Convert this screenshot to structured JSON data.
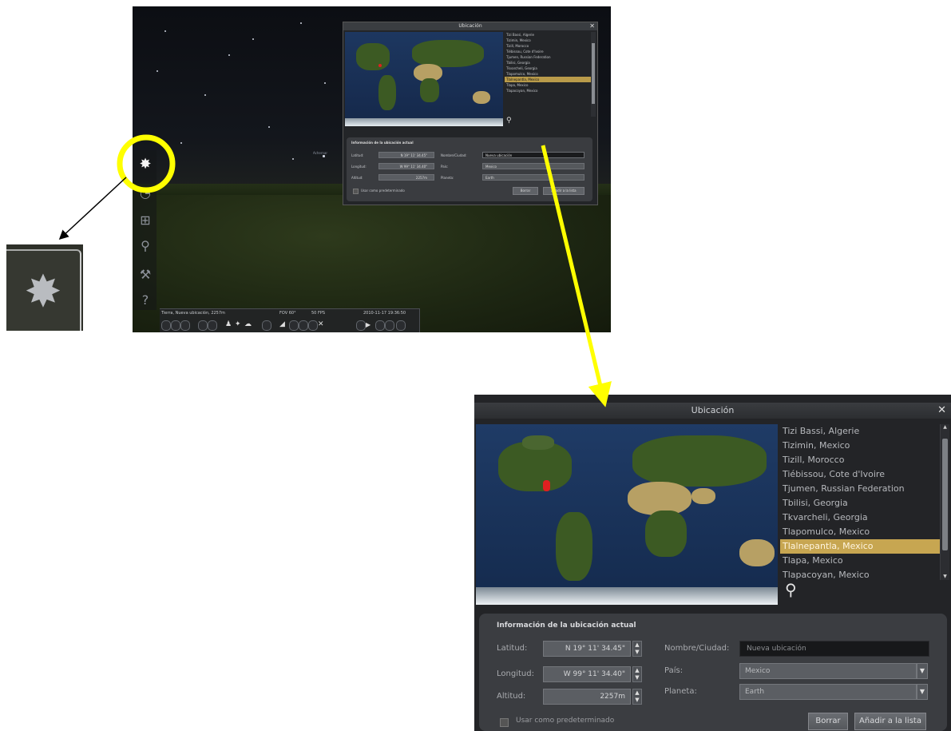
{
  "small_window": {
    "title": "Ubicación",
    "close": "✕",
    "locations": [
      "Tizi Bassi, Algerie",
      "Tizimin, Mexico",
      "Tizill, Morocco",
      "Tiébissou, Cote d'Ivoire",
      "Tjumen, Russian Federation",
      "Tbilisi, Georgia",
      "Tkvarcheli, Georgia",
      "Tlapomulco, Mexico",
      "Tlalnepantla, Mexico",
      "Tlapa, Mexico",
      "Tlapacoyan, Mexico"
    ],
    "selected_index": 8,
    "info_heading": "Información de la ubicación actual",
    "latitud_label": "Latitud:",
    "latitud_value": "N 19° 11' 34.45\"",
    "longitud_label": "Longitud:",
    "longitud_value": "W 99° 11' 34.40\"",
    "altitud_label": "Altitud:",
    "altitud_value": "2257m",
    "nombre_label": "Nombre/Ciudad:",
    "nombre_value": "Nueva ubicación",
    "pais_label": "País:",
    "pais_value": "Mexico",
    "planeta_label": "Planeta:",
    "planeta_value": "Earth",
    "default_label": "Usar como predeterminado",
    "delete_button": "Borrar",
    "add_button": "Añadir a la lista"
  },
  "status_bar": {
    "location": "Tierra, Nueva ubicación, 2257m",
    "fov": "FOV 60°",
    "fps": "50 FPS",
    "datetime": "2010-11-17   19:36:50"
  },
  "sky_label": "Achernar",
  "large_window": {
    "title": "Ubicación",
    "close": "✕",
    "locations": [
      "Tizi Bassi, Algerie",
      "Tizimin, Mexico",
      "Tizill, Morocco",
      "Tiébissou, Cote d'Ivoire",
      "Tjumen, Russian Federation",
      "Tbilisi, Georgia",
      "Tkvarcheli, Georgia",
      "Tlapomulco, Mexico",
      "Tlalnepantla, Mexico",
      "Tlapa, Mexico",
      "Tlapacoyan, Mexico"
    ],
    "selected_index": 8,
    "info_heading": "Información de la ubicación actual",
    "latitud_label": "Latitud:",
    "latitud_value": "N 19° 11' 34.45\"",
    "longitud_label": "Longitud:",
    "longitud_value": "W 99° 11' 34.40\"",
    "altitud_label": "Altitud:",
    "altitud_value": "2257m",
    "nombre_label": "Nombre/Ciudad:",
    "nombre_value": "Nueva ubicación",
    "pais_label": "País:",
    "pais_value": "Mexico",
    "planeta_label": "Planeta:",
    "planeta_value": "Earth",
    "default_label": "Usar como predeterminado",
    "delete_button": "Borrar",
    "add_button": "Añadir a la lista"
  },
  "sidebar_icons": [
    "location-icon",
    "clock-icon",
    "sky-view-icon",
    "search-icon",
    "settings-icon",
    "help-icon"
  ],
  "colors": {
    "highlight": "#ffff00",
    "selected_row": "#c7a651",
    "marker": "#e02020"
  }
}
